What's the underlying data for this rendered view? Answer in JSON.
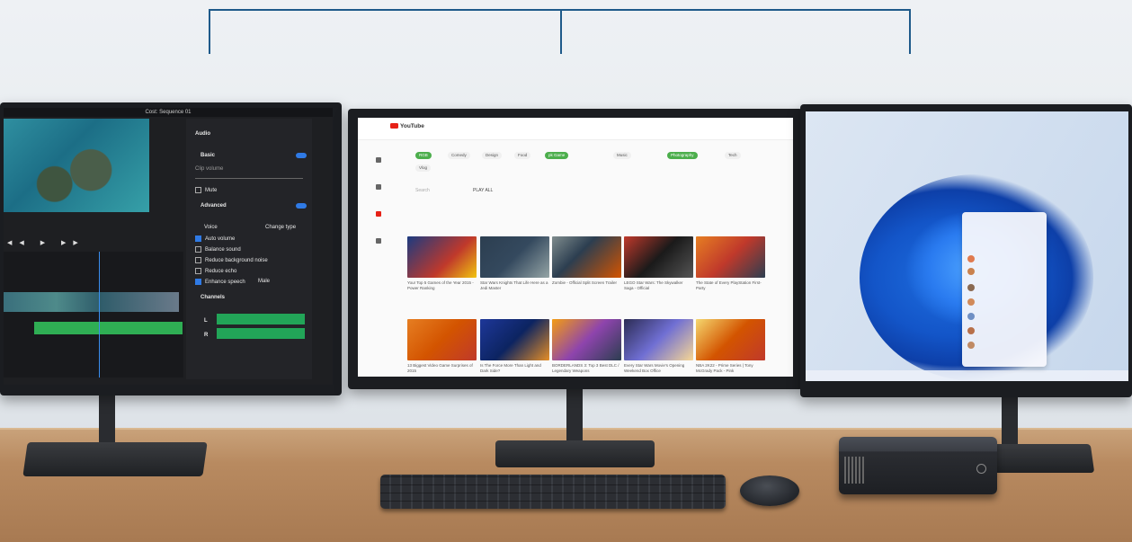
{
  "left_screen": {
    "title": "Cost: Sequence 01",
    "panel": {
      "section": "Audio",
      "basic": "Basic",
      "clip_volume": "Clip volume",
      "mute": "Mute",
      "advanced": "Advanced",
      "voice": "Voice",
      "change_type": "Change type",
      "options": [
        "Auto volume",
        "Balance sound",
        "Reduce background noise",
        "Reduce echo",
        "Enhance speech"
      ],
      "enhance_value": "Male",
      "channels": "Channels",
      "channel_l": "L",
      "channel_r": "R"
    }
  },
  "center_screen": {
    "logo": "YouTube",
    "chips": [
      "RGB",
      "Comedy",
      "Design",
      "Food",
      "pk Game",
      "Music",
      "Photography",
      "Tech",
      "Vlog"
    ],
    "search_placeholder": "Search",
    "play_all": "PLAY ALL",
    "row1_captions": [
      "Your Top 5 Games of the Year 2015 - Power Ranking",
      "Star Wars Knights That Life Here as a Jedi Master",
      "Zombie - Official Split Screen Trailer",
      "LEGO Star Wars: The Skywalker Saga - Official",
      "The State of Every PlayStation First-Party"
    ],
    "row2_captions": [
      "13 Biggest Video Game Surprises of 2015",
      "Is The Force More Than Light and Dark Side?",
      "BORDERLANDS 3: Top 3 Best DLC / Legendary Weapons",
      "Every Star Wars Movie's Opening Weekend Box Office",
      "NBA 2K22 - Prime Series | Tony McGrady Pack - Pink"
    ]
  },
  "colors": {
    "accent_blue": "#2f7ae5",
    "chip_green": "#4cae4c",
    "brand_red": "#e62117",
    "bracket": "#1e5a8a"
  }
}
